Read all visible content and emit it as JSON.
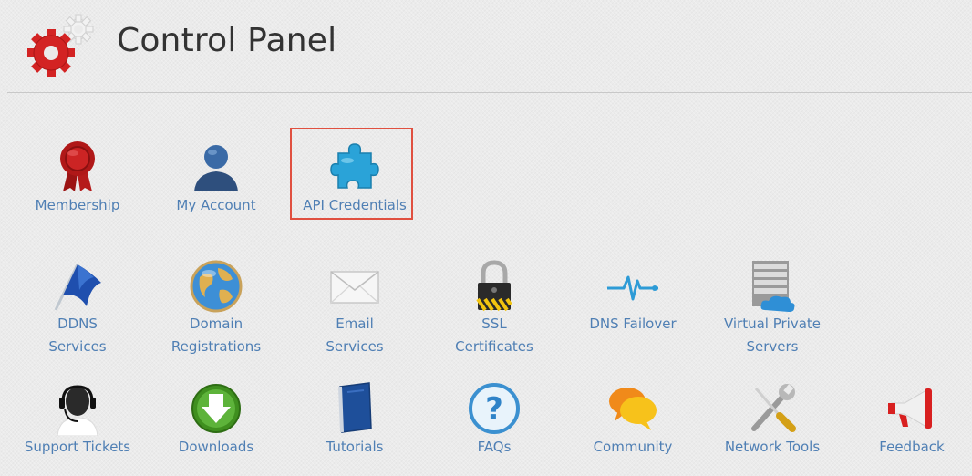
{
  "header": {
    "title": "Control Panel",
    "logo_icon": "gears-logo-icon"
  },
  "colors": {
    "link": "#4f7fb4",
    "highlight": "#e05040",
    "title": "#333333"
  },
  "row1": [
    {
      "label": "Membership",
      "icon": "ribbon-badge-icon"
    },
    {
      "label": "My Account",
      "icon": "user-icon"
    },
    {
      "label": "API Credentials",
      "icon": "puzzle-piece-icon",
      "highlighted": true
    }
  ],
  "row2": [
    {
      "label_line1": "DDNS",
      "label_line2": "Services",
      "icon": "flag-icon"
    },
    {
      "label_line1": "Domain",
      "label_line2": "Registrations",
      "icon": "globe-icon"
    },
    {
      "label_line1": "Email",
      "label_line2": "Services",
      "icon": "envelope-icon"
    },
    {
      "label_line1": "SSL",
      "label_line2": "Certificates",
      "icon": "padlock-icon"
    },
    {
      "label_line1": "DNS Failover",
      "label_line2": "",
      "icon": "heartbeat-icon"
    },
    {
      "label_line1": "Virtual Private",
      "label_line2": "Servers",
      "icon": "server-cloud-icon"
    }
  ],
  "row3": [
    {
      "label": "Support Tickets",
      "icon": "headset-icon"
    },
    {
      "label": "Downloads",
      "icon": "download-arrow-icon"
    },
    {
      "label": "Tutorials",
      "icon": "notebook-icon"
    },
    {
      "label": "FAQs",
      "icon": "question-mark-icon"
    },
    {
      "label": "Community",
      "icon": "chat-bubbles-icon"
    },
    {
      "label": "Network Tools",
      "icon": "wrench-screwdriver-icon"
    },
    {
      "label": "Feedback",
      "icon": "megaphone-icon"
    }
  ]
}
